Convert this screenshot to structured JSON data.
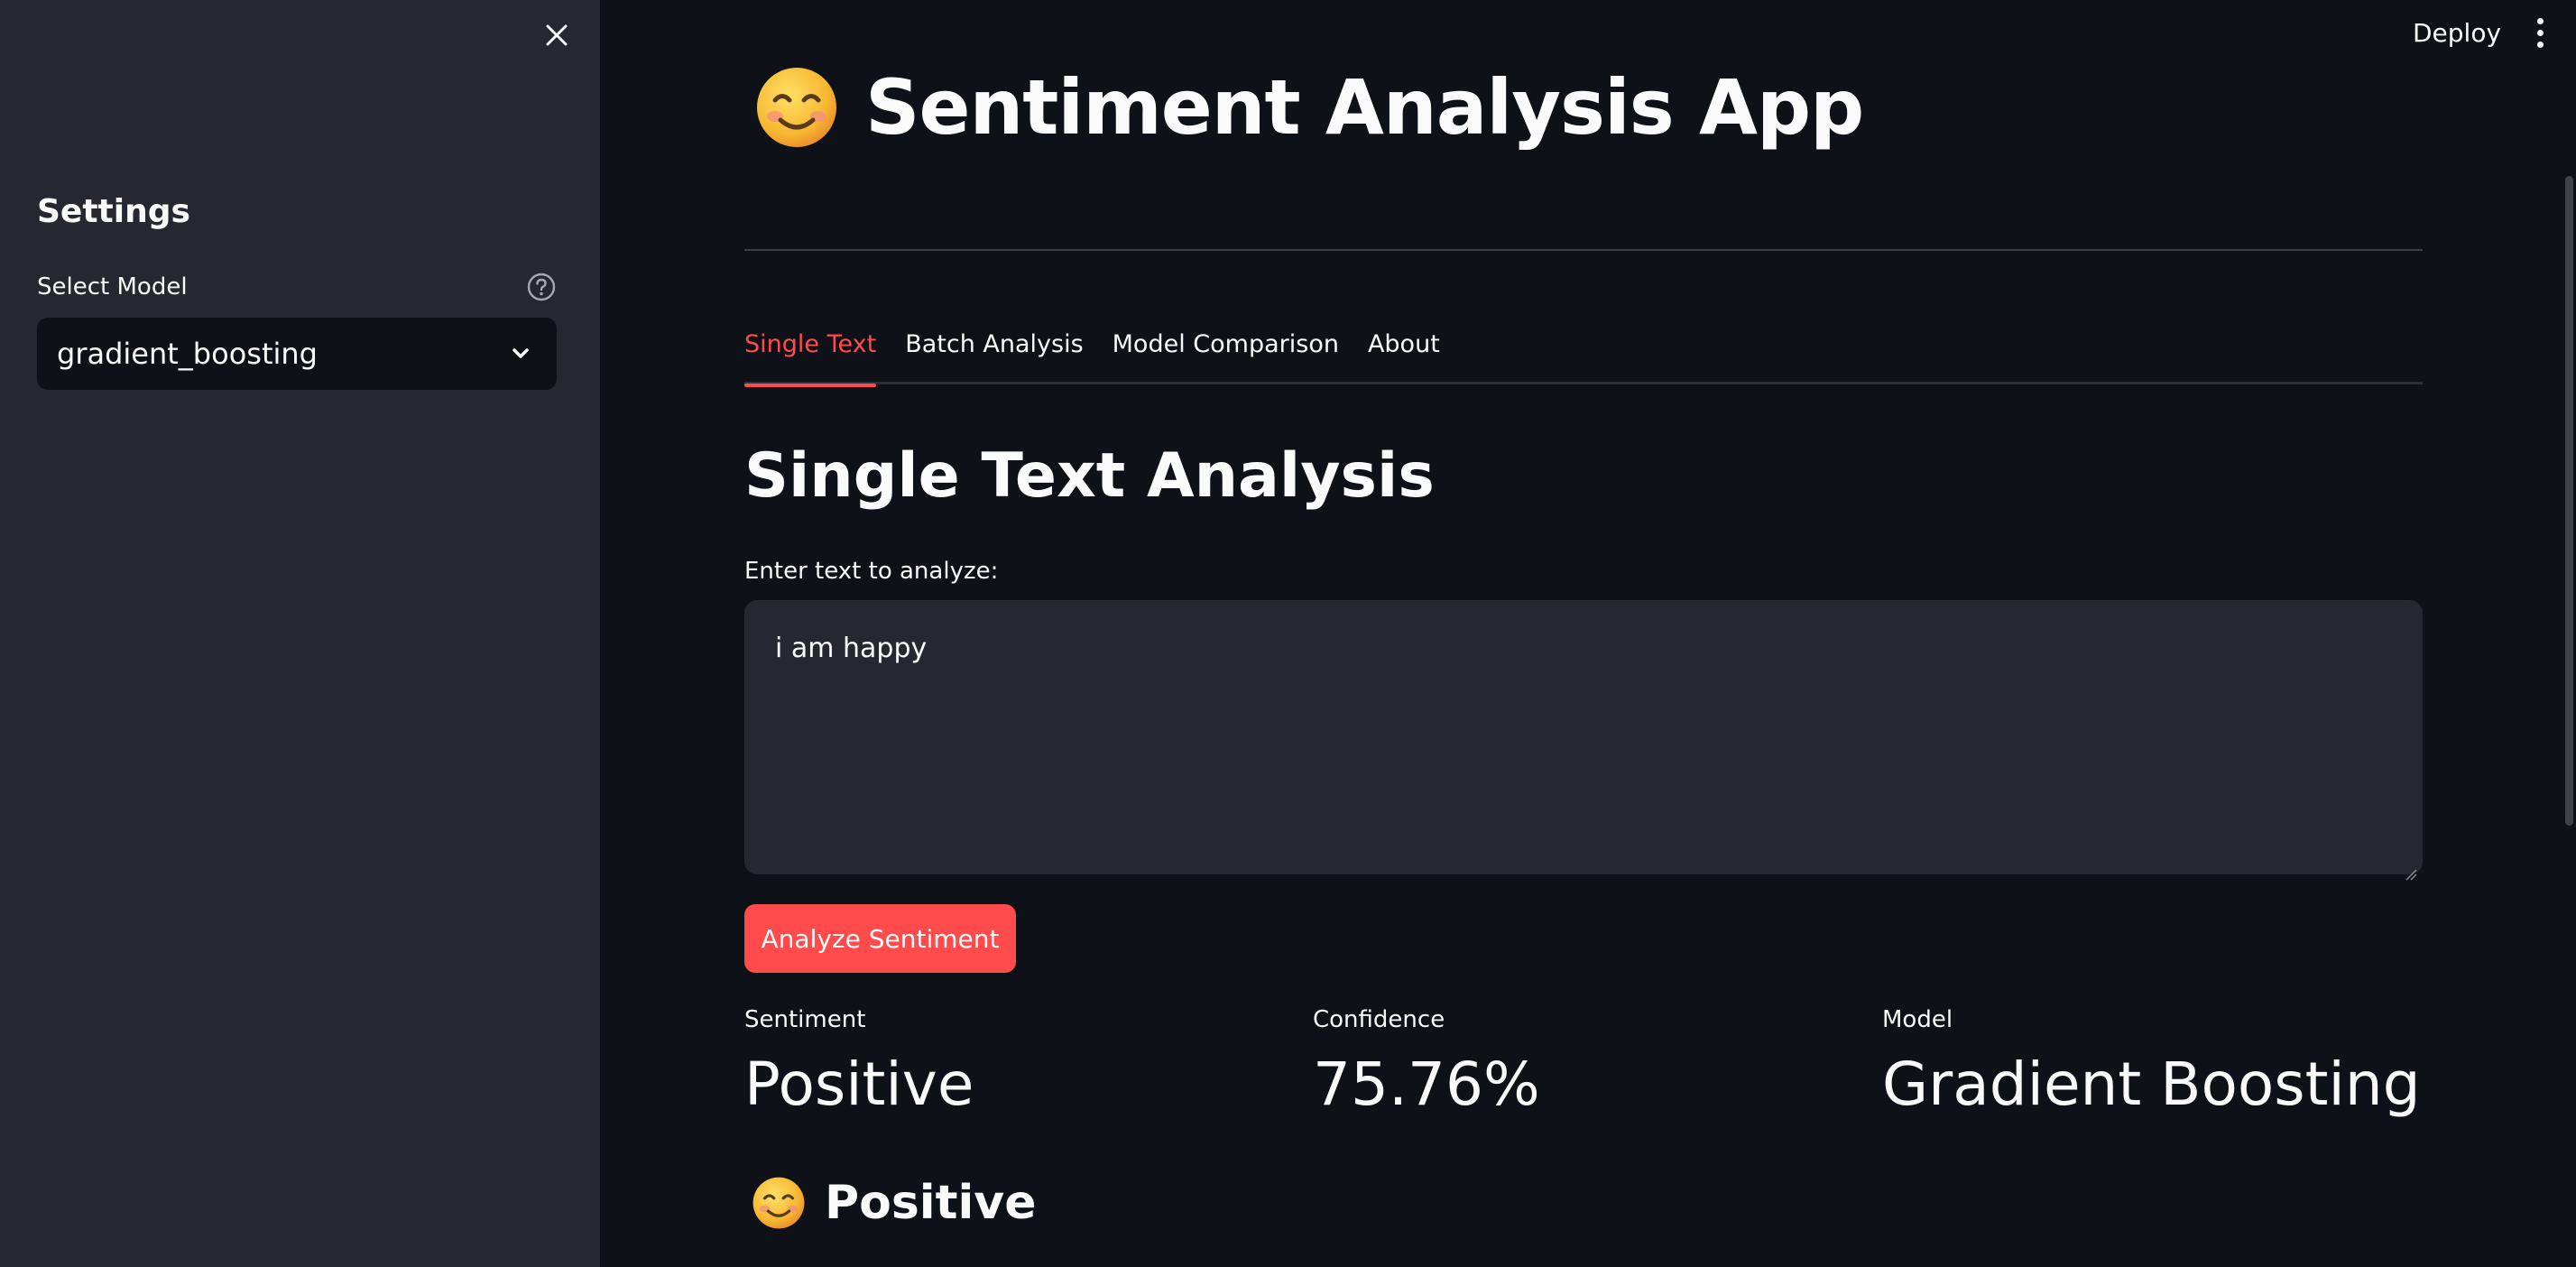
{
  "sidebar": {
    "title": "Settings",
    "select_label": "Select Model",
    "selected_model": "gradient_boosting",
    "icons": {
      "close": "close-icon",
      "help": "help-circle-icon",
      "dropdown": "chevron-down-icon"
    }
  },
  "header": {
    "deploy_label": "Deploy",
    "menu_icon": "kebab-menu-icon"
  },
  "main": {
    "title": "Sentiment Analysis App",
    "title_icon": "smiling-face-emoji",
    "tabs": [
      {
        "label": "Single Text",
        "active": true
      },
      {
        "label": "Batch Analysis",
        "active": false
      },
      {
        "label": "Model Comparison",
        "active": false
      },
      {
        "label": "About",
        "active": false
      }
    ],
    "section_title": "Single Text Analysis",
    "input_label": "Enter text to analyze:",
    "input_value": "i am happy",
    "analyze_button": "Analyze Sentiment",
    "metrics": [
      {
        "label": "Sentiment",
        "value": "Positive"
      },
      {
        "label": "Confidence",
        "value": "75.76%"
      },
      {
        "label": "Model",
        "value": "Gradient Boosting"
      }
    ],
    "result": {
      "icon": "smiling-face-emoji",
      "label": "Positive"
    }
  },
  "colors": {
    "background": "#0e1117",
    "sidebar": "#262730",
    "accent": "#ff4b4b",
    "text": "#fafafa"
  }
}
